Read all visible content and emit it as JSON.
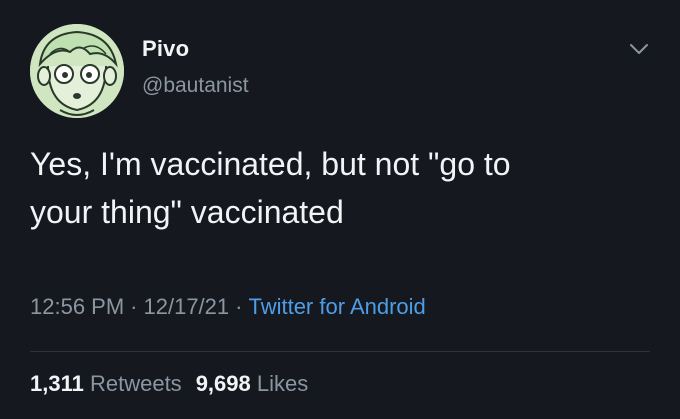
{
  "author": {
    "display_name": "Pivo",
    "handle": "@bautanist",
    "avatar_icon": "cartoon-face-avatar"
  },
  "tweet": {
    "text": "Yes, I'm vaccinated, but not \"go to\nyour thing\" vaccinated",
    "time": "12:56 PM",
    "date": "12/17/21",
    "separator": "·",
    "source": "Twitter for Android"
  },
  "stats": {
    "retweets_count": "1,311",
    "retweets_label": "Retweets",
    "likes_count": "9,698",
    "likes_label": "Likes"
  },
  "colors": {
    "background": "#15181f",
    "text": "#f1f3f5",
    "muted": "#8c96a1",
    "link": "#4d9ee6"
  }
}
